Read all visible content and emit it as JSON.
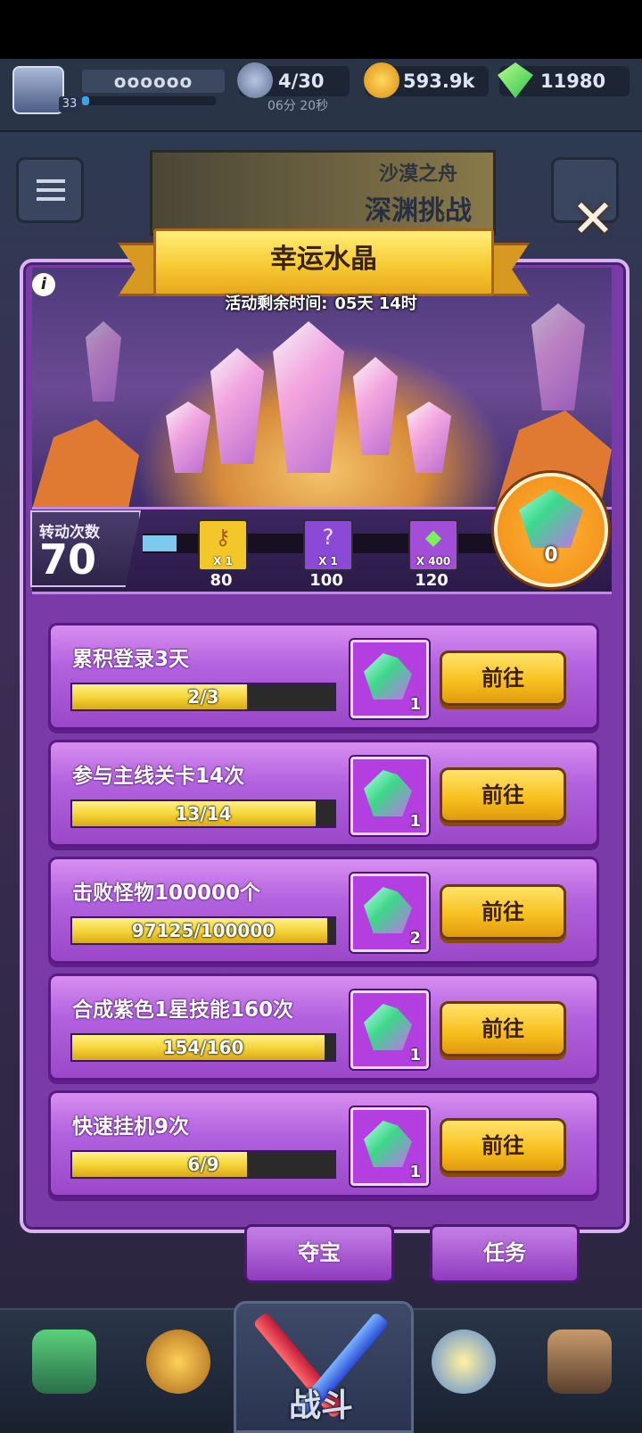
{
  "player": {
    "name": "oooooo",
    "level": "33",
    "xp_fraction": 0.05
  },
  "resources": {
    "energy": {
      "value": "4/30",
      "timer": "06分 20秒"
    },
    "gold": {
      "value": "593.9k"
    },
    "gems": {
      "value": "11980"
    }
  },
  "event_banner": {
    "line1": "沙漠之舟",
    "line2": "深渊挑战"
  },
  "modal": {
    "title": "幸运水晶",
    "timer_label": "活动剩余时间:",
    "timer_value": "05天 14时",
    "spin_label": "转动次数",
    "spin_count": "70",
    "crystal_count": "0",
    "milestones": [
      {
        "qty": "X 1",
        "threshold": "80",
        "icon": "key-icon",
        "color": "#f3c729"
      },
      {
        "qty": "X 1",
        "threshold": "100",
        "icon": "mystery-box-icon",
        "color": "#8a4ad6"
      },
      {
        "qty": "X 400",
        "threshold": "120",
        "icon": "gem-icon",
        "color": "#a24ed8"
      }
    ],
    "tasks": [
      {
        "title": "累积登录3天",
        "progress": "2/3",
        "fraction": 0.6667,
        "reward_qty": "1",
        "button": "前往"
      },
      {
        "title": "参与主线关卡14次",
        "progress": "13/14",
        "fraction": 0.9286,
        "reward_qty": "1",
        "button": "前往"
      },
      {
        "title": "击败怪物100000个",
        "progress": "97125/100000",
        "fraction": 0.97125,
        "reward_qty": "2",
        "button": "前往"
      },
      {
        "title": "合成紫色1星技能160次",
        "progress": "154/160",
        "fraction": 0.9625,
        "reward_qty": "1",
        "button": "前往"
      },
      {
        "title": "快速挂机9次",
        "progress": "6/9",
        "fraction": 0.6667,
        "reward_qty": "1",
        "button": "前往"
      }
    ]
  },
  "subtabs": [
    "夺宝",
    "任务"
  ],
  "bottom_nav": {
    "battle_label": "战斗"
  },
  "colors": {
    "accent_gold": "#f6c933",
    "panel_purple": "#7a3aa8",
    "button_gold": "#f8c120"
  }
}
